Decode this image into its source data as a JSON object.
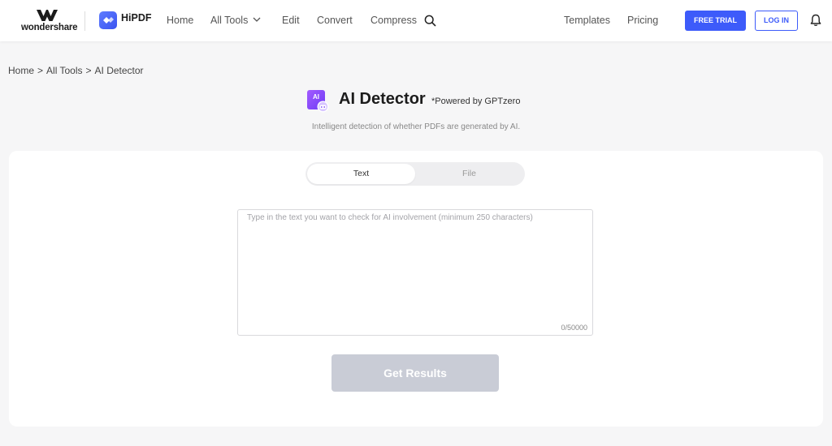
{
  "brand": {
    "company": "wondershare",
    "product": "HiPDF"
  },
  "nav": {
    "items": [
      {
        "label": "Home"
      },
      {
        "label": "All Tools"
      },
      {
        "label": "Edit"
      },
      {
        "label": "Convert"
      },
      {
        "label": "Compress"
      }
    ],
    "templates": "Templates",
    "pricing": "Pricing",
    "free_trial": "FREE TRIAL",
    "login": "LOG IN"
  },
  "breadcrumb": {
    "home": "Home",
    "all_tools": "All Tools",
    "current": "AI Detector",
    "separator": ">"
  },
  "page": {
    "title": "AI Detector",
    "powered_by": "*Powered by GPTzero",
    "subtitle": "Intelligent detection of whether PDFs are generated by AI.",
    "icon_label": "AI"
  },
  "tabs": [
    {
      "label": "Text",
      "active": true
    },
    {
      "label": "File",
      "active": false
    }
  ],
  "input": {
    "placeholder": "Type in the text you want to check for AI involvement (minimum 250 characters)",
    "value": "",
    "counter": "0/50000"
  },
  "submit_label": "Get Results",
  "colors": {
    "accent": "#3d5bfa",
    "icon_purple": "#8a4bff",
    "disabled_button": "#c9ccd6"
  }
}
